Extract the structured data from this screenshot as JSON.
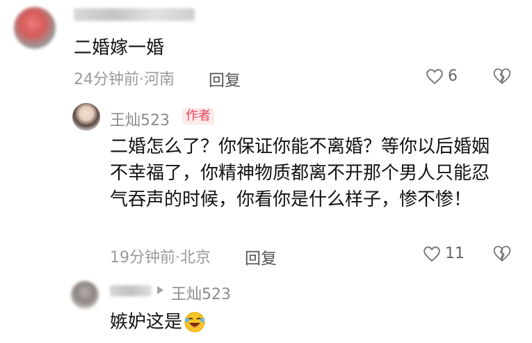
{
  "comments": [
    {
      "user": "",
      "text": "二婚嫁一婚",
      "meta": "24分钟前·河南",
      "reply_label": "回复",
      "likes": "6"
    },
    {
      "user": "王灿523",
      "badge": "作者",
      "text": "二婚怎么了？你保证你能不离婚？等你以后婚姻不幸福了，你精神物质都离不开那个男人只能忍气吞声的时候，你看你是什么样子，惨不惨！",
      "meta": "19分钟前·北京",
      "reply_label": "回复",
      "likes": "11"
    },
    {
      "user": "",
      "reply_to": "王灿523",
      "text": "嫉妒这是"
    }
  ],
  "colors": {
    "author_badge_bg": "#fdeaea",
    "author_badge_text": "#e8455a"
  },
  "icons": [
    "heart-icon",
    "broken-heart-icon",
    "reply-arrow-icon",
    "laughing-emoji-icon"
  ]
}
